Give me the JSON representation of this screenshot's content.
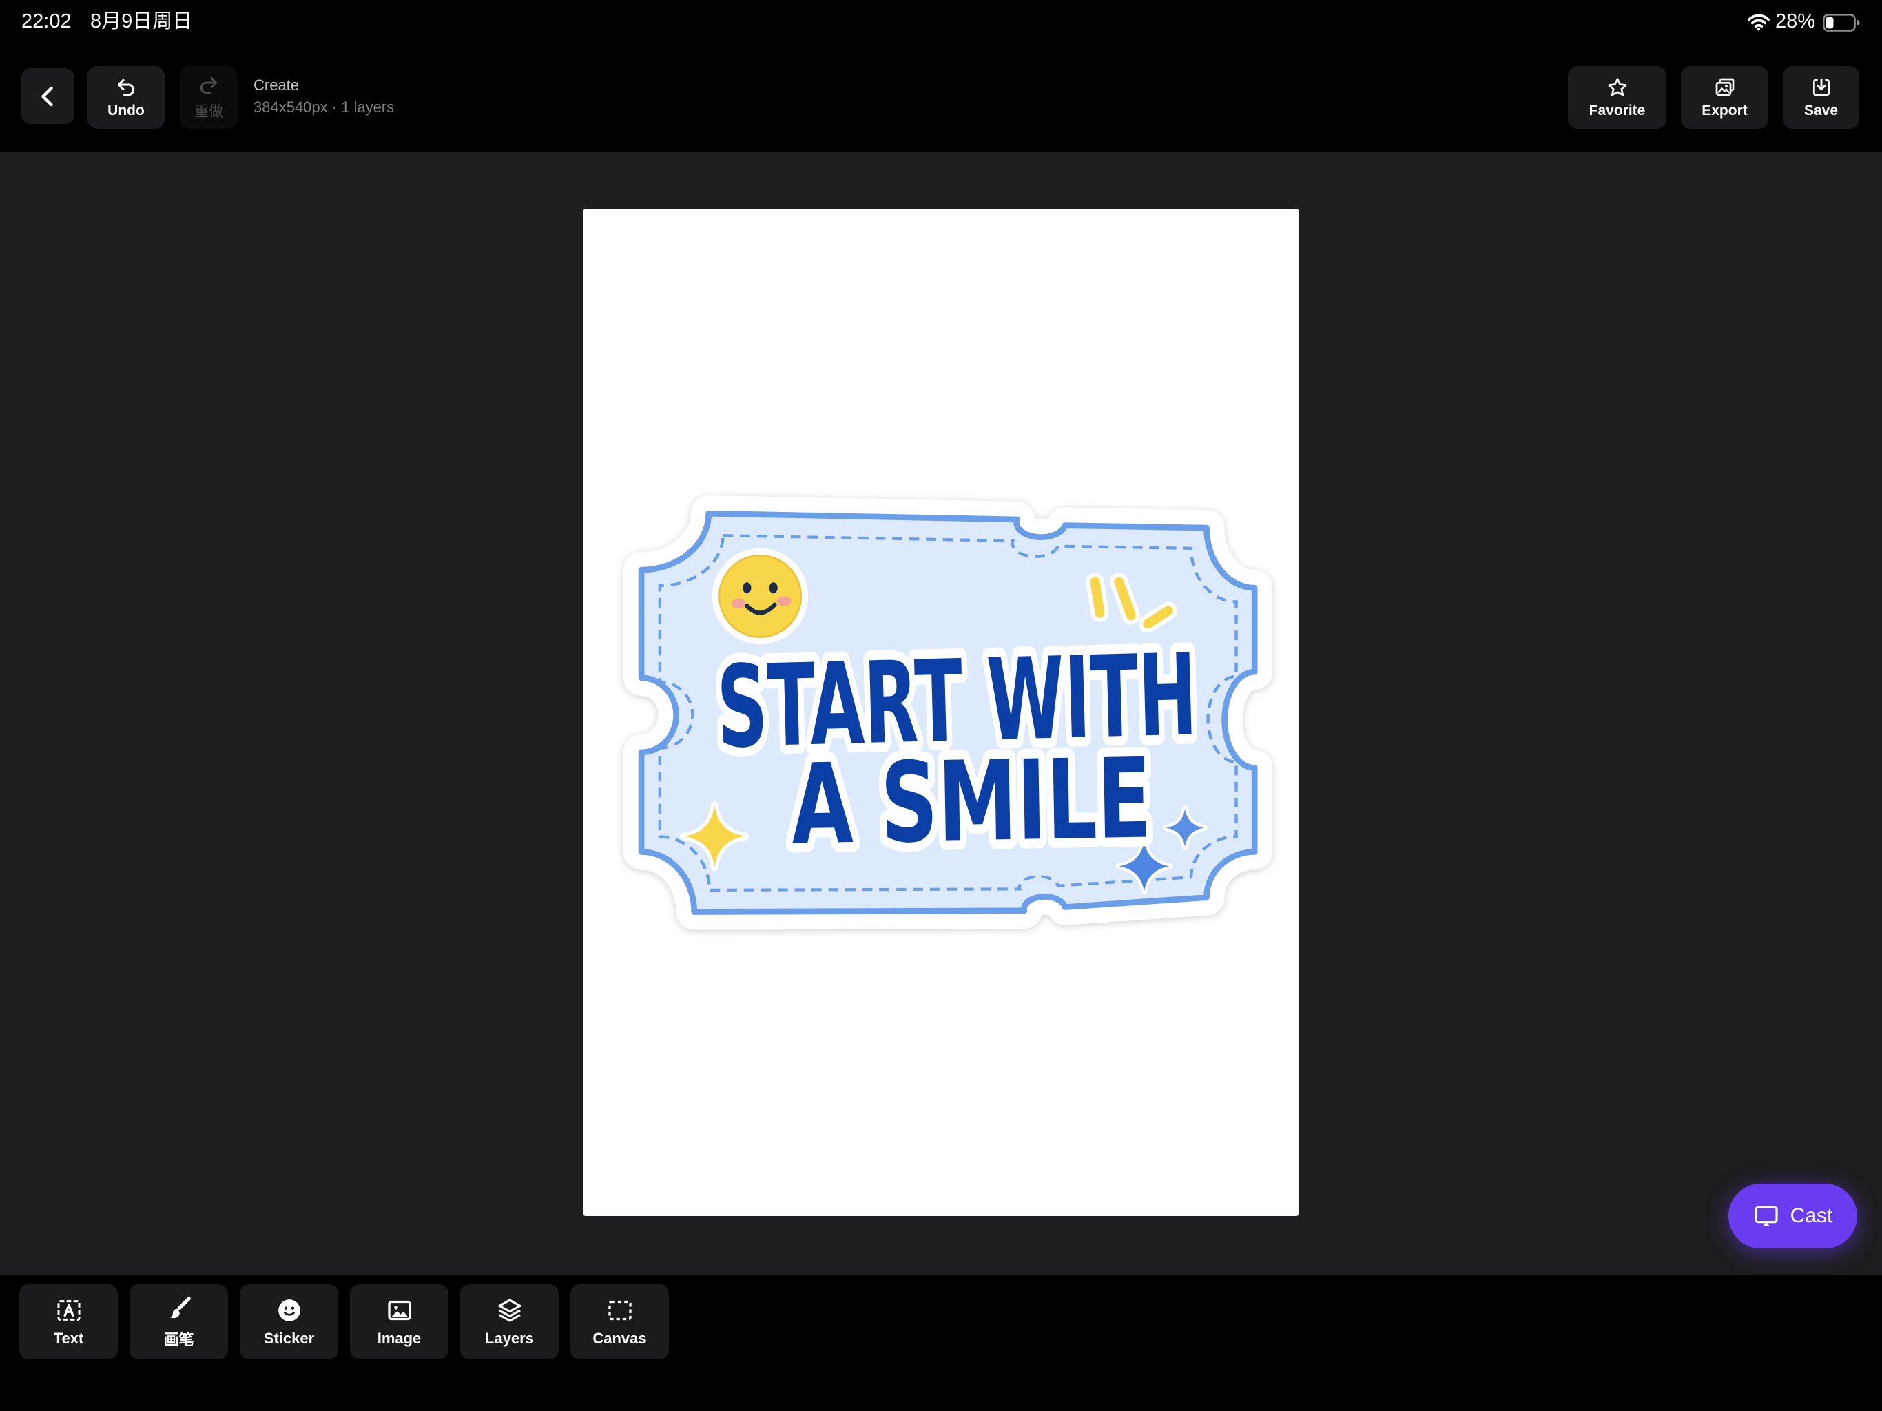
{
  "status_bar": {
    "time": "22:02",
    "date": "8月9日周日",
    "battery_percent": "28%",
    "battery_level": 0.28
  },
  "toolbar": {
    "back_icon": "chevron-left-icon",
    "undo_label": "Undo",
    "redo_label": "重做",
    "redo_enabled": false,
    "title": "Create",
    "subtitle": "384x540px · 1 layers",
    "favorite_label": "Favorite",
    "export_label": "Export",
    "save_label": "Save"
  },
  "canvas": {
    "sticker": {
      "line1": "START WITH",
      "line2": "A SMILE"
    }
  },
  "cast": {
    "label": "Cast",
    "icon": "cast-screen-icon"
  },
  "bottom_tools": [
    {
      "label": "Text",
      "icon": "text-box-icon"
    },
    {
      "label": "画笔",
      "icon": "brush-icon"
    },
    {
      "label": "Sticker",
      "icon": "smiley-icon"
    },
    {
      "label": "Image",
      "icon": "image-icon"
    },
    {
      "label": "Layers",
      "icon": "layers-icon"
    },
    {
      "label": "Canvas",
      "icon": "dashed-rect-icon"
    }
  ],
  "colors": {
    "accent": "#6a3cf0",
    "workspace": "#1e1e20",
    "toolbar": "#000000",
    "button": "#1b1b1d",
    "canvas": "#ffffff",
    "sticker_text": "#0c3fa6",
    "sticker_border": "#6b9ee8",
    "sticker_fill": "#dceafb",
    "sticker_yellow": "#f8d649"
  }
}
